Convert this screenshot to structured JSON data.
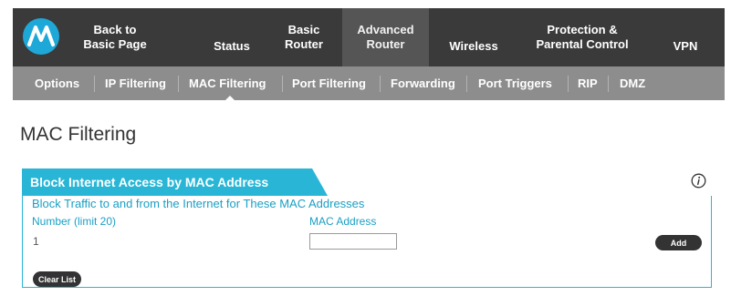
{
  "logo": {
    "icon": "motorola-logo",
    "color": "#1ea8d8"
  },
  "topnav": {
    "tabs": [
      {
        "label": "Back to\nBasic Page"
      },
      {
        "label": "Status"
      },
      {
        "label": "Basic\nRouter"
      },
      {
        "label": "Advanced\nRouter",
        "active": true
      },
      {
        "label": "Wireless"
      },
      {
        "label": "Protection &\nParental Control"
      },
      {
        "label": "VPN"
      }
    ]
  },
  "subnav": {
    "items": [
      {
        "label": "Options"
      },
      {
        "label": "IP Filtering"
      },
      {
        "label": "MAC Filtering",
        "active": true
      },
      {
        "label": "Port Filtering"
      },
      {
        "label": "Forwarding"
      },
      {
        "label": "Port Triggers"
      },
      {
        "label": "RIP"
      },
      {
        "label": "DMZ"
      }
    ]
  },
  "page": {
    "title": "MAC Filtering",
    "info_icon": "info-icon"
  },
  "section": {
    "header": "Block Internet Access by MAC Address",
    "subtitle": "Block Traffic to and from the Internet for These MAC Addresses",
    "col_number": "Number (limit 20)",
    "col_mac": "MAC Address",
    "rows": [
      {
        "number": "1",
        "mac": ""
      }
    ],
    "add_label": "Add",
    "clear_label": "Clear List"
  },
  "colors": {
    "accent": "#29b6d6",
    "nav_dark": "#3a3a3a",
    "nav_active": "#555555",
    "subnav": "#8d8d8d",
    "button": "#333333"
  }
}
